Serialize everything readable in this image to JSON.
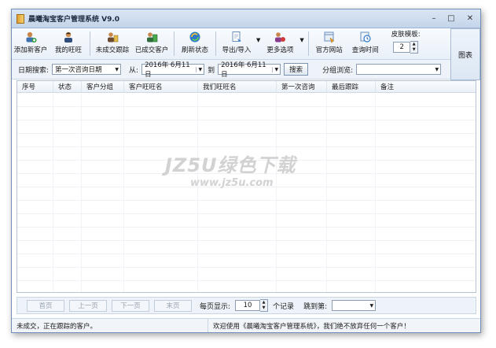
{
  "window": {
    "title": "晨曦淘宝客户管理系统 V9.0"
  },
  "toolbar": {
    "buttons": [
      {
        "label": "添加新客户",
        "icon": "add-customer-icon"
      },
      {
        "label": "我的旺旺",
        "icon": "wangwang-icon"
      },
      {
        "label": "未成交跟踪",
        "icon": "track-icon"
      },
      {
        "label": "已成交客户",
        "icon": "deal-customer-icon"
      },
      {
        "label": "刷新状态",
        "icon": "refresh-icon"
      },
      {
        "label": "导出/导入",
        "icon": "export-import-icon"
      },
      {
        "label": "更多选项",
        "icon": "more-options-icon"
      },
      {
        "label": "官方网站",
        "icon": "website-icon"
      },
      {
        "label": "查询时间",
        "icon": "query-time-icon"
      }
    ],
    "skin_label": "皮肤模板:",
    "skin_value": "2",
    "chart_button": "图表"
  },
  "filter": {
    "date_label": "日期搜索:",
    "date_type": "第一次咨询日期",
    "from_label": "从:",
    "from_date": "2016年 6月11日",
    "to_label": "到",
    "to_date": "2016年 6月11日",
    "search_button": "搜索",
    "group_label": "分组浏览:",
    "group_value": ""
  },
  "grid": {
    "columns": [
      "序号",
      "状态",
      "客户分组",
      "客户旺旺名",
      "我们旺旺名",
      "第一次咨询",
      "最后跟踪",
      "备注"
    ]
  },
  "watermark": {
    "line1": "JZ5U绿色下载",
    "line2": "www.jz5u.com"
  },
  "pager": {
    "first": "首页",
    "prev": "上一页",
    "next": "下一页",
    "last": "末页",
    "per_page_label": "每页显示:",
    "per_page_value": "10",
    "records_label": "个记录",
    "jump_label": "跳到第:",
    "jump_value": ""
  },
  "status": {
    "left": "未成交，正在跟踪的客户。",
    "right": "欢迎使用《晨曦淘宝客户管理系统》，我们绝不放弃任何一个客户！"
  }
}
